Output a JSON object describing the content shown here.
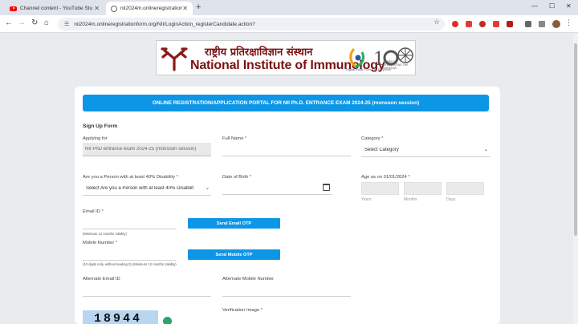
{
  "browser": {
    "tabs": [
      {
        "label": "Channel content - YouTube Stu",
        "active": false
      },
      {
        "label": "nii2024m.onlineregistrationfo",
        "active": true
      }
    ],
    "url": "nii2024m.onlineregistrationform.org/NII/LoginAction_registerCandidate.action?"
  },
  "banner": {
    "hindi_name": "राष्ट्रीय प्रतिरक्षाविज्ञान संस्थान",
    "english_name": "National Institute of Immunology",
    "digital_india": "Digital India",
    "digital_india_tagline": "Power To Empower",
    "anniversary_text": "YEARS OF CELEBRATING THE MAHATMA"
  },
  "form": {
    "header": "ONLINE REGISTRATION/APPLICATION PORTAL FOR NII Ph.D. ENTRANCE EXAM 2024-25 (monsoon session)",
    "section_title": "Sign Up Form",
    "applying_for": {
      "label": "Applying for",
      "value": "NII PhD entrance exam 2024-25 (monsoon session)"
    },
    "full_name": {
      "label": "Full Name",
      "value": ""
    },
    "category": {
      "label": "Category",
      "value": "Select Category"
    },
    "disability": {
      "label": "Are you a Person with at least 40% Disability",
      "value": "Select Are you a Person with at least 40% Disabilit"
    },
    "dob": {
      "label": "Date of Birth",
      "value": ""
    },
    "age": {
      "label": "Age as on 01/01/2024",
      "years": "Years",
      "months": "Months",
      "days": "Days"
    },
    "email": {
      "label": "Email ID",
      "hint": "(Minimum 12 months Validity)",
      "otp_button": "Send Email OTP"
    },
    "mobile": {
      "label": "Mobile Number",
      "hint": "(10 digits only, without leading 0) (Minimum 12 months Validity)",
      "otp_button": "Send Mobile OTP"
    },
    "alt_email": {
      "label": "Alternate Email ID"
    },
    "alt_mobile": {
      "label": "Alternate Mobile Number"
    },
    "verification": {
      "label": "Verification Image",
      "captcha": "18944"
    },
    "required_mark": "*"
  }
}
